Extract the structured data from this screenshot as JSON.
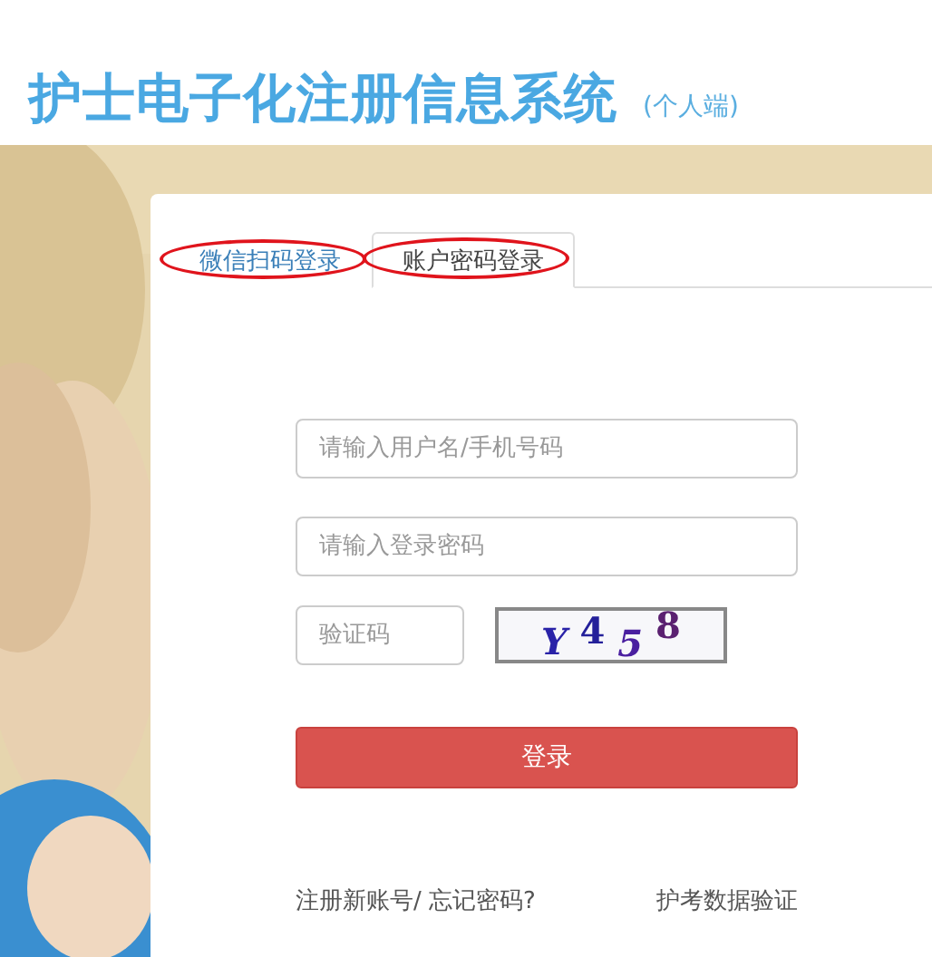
{
  "header": {
    "title": "护士电子化注册信息系统",
    "subtitle": "(个人端)"
  },
  "tabs": [
    {
      "label": "微信扫码登录",
      "selected": false,
      "annotated": true
    },
    {
      "label": "账户密码登录",
      "selected": true,
      "annotated": true
    }
  ],
  "form": {
    "username": {
      "placeholder": "请输入用户名/手机号码"
    },
    "password": {
      "placeholder": "请输入登录密码"
    },
    "captcha": {
      "placeholder": "验证码",
      "code": "Y 4 5 8"
    },
    "submit": "登录"
  },
  "links": [
    {
      "label": "注册新账号/ 忘记密码?"
    },
    {
      "label": "护考数据验证"
    }
  ]
}
